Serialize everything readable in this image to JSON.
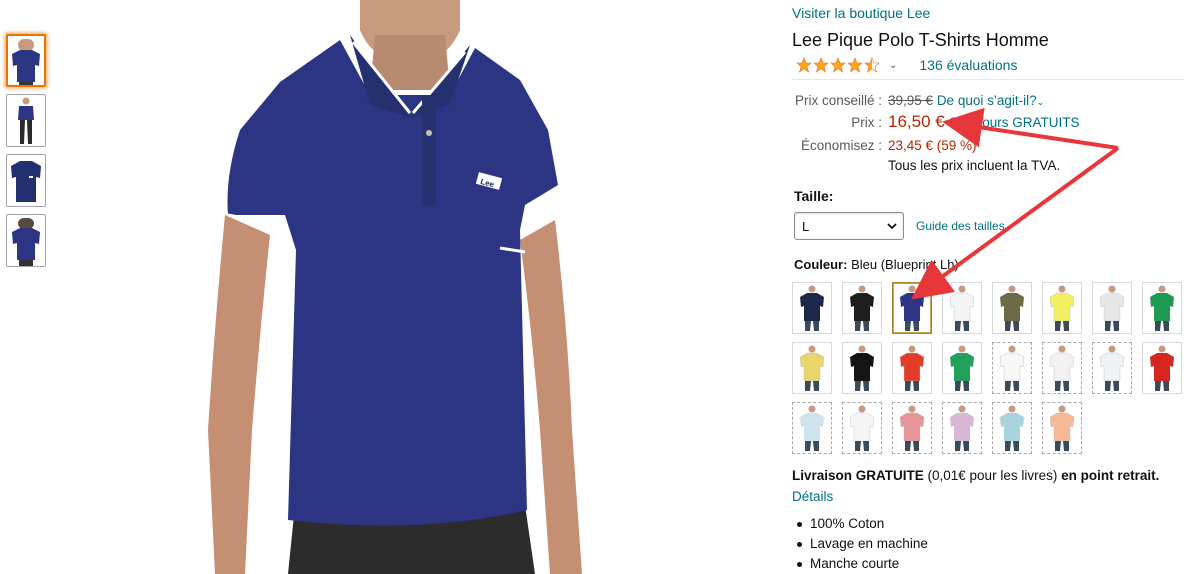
{
  "store": {
    "link": "Visiter la boutique Lee"
  },
  "product": {
    "title": "Lee Pique Polo T-Shirts Homme",
    "rating": 4.5,
    "rating_count": "136 évaluations"
  },
  "pricing": {
    "list_label": "Prix conseillé :",
    "list_price": "39,95 €",
    "list_help": "De quoi s’agit-il?",
    "price_label": "Prix :",
    "price": "16,50 €",
    "price_suffix": "& Retours GRATUITS",
    "save_label": "Économisez :",
    "save_value": "23,45 € (59 %)",
    "vat_note": "Tous les prix incluent la TVA."
  },
  "size": {
    "label": "Taille:",
    "selected": "L",
    "guide": "Guide des tailles"
  },
  "color": {
    "label": "Couleur:",
    "value": "Bleu (Blueprint Lh)",
    "swatches": [
      {
        "name": "navy-polo",
        "color": "#1d2749",
        "selected": false,
        "dashed": false
      },
      {
        "name": "black-polo",
        "color": "#1e1e1e",
        "selected": false,
        "dashed": false
      },
      {
        "name": "blue-polo",
        "color": "#2b3584",
        "selected": true,
        "dashed": false
      },
      {
        "name": "white-polo",
        "color": "#f4f4f4",
        "selected": false,
        "dashed": false
      },
      {
        "name": "olive-polo",
        "color": "#6b6a45",
        "selected": false,
        "dashed": false
      },
      {
        "name": "yellow-polo",
        "color": "#f2ef63",
        "selected": false,
        "dashed": false
      },
      {
        "name": "grey-white-polo",
        "color": "#e6e6e6",
        "selected": false,
        "dashed": false
      },
      {
        "name": "green-polo",
        "color": "#1f9a55",
        "selected": false,
        "dashed": false
      },
      {
        "name": "mustard-polo",
        "color": "#e8d66a",
        "selected": false,
        "dashed": false
      },
      {
        "name": "black-polo-2",
        "color": "#151515",
        "selected": false,
        "dashed": false
      },
      {
        "name": "red-polo",
        "color": "#e43c2b",
        "selected": false,
        "dashed": false
      },
      {
        "name": "green-polo-2",
        "color": "#23a05a",
        "selected": false,
        "dashed": false
      },
      {
        "name": "white-polo-2",
        "color": "#f7f7f7",
        "selected": false,
        "dashed": true
      },
      {
        "name": "white-polo-3",
        "color": "#f2f2f2",
        "selected": false,
        "dashed": true
      },
      {
        "name": "white-polo-4",
        "color": "#eef2f4",
        "selected": false,
        "dashed": true
      },
      {
        "name": "red-polo-2",
        "color": "#d7261d",
        "selected": false,
        "dashed": false
      },
      {
        "name": "striped-polo",
        "color": "#cfe3ef",
        "selected": false,
        "dashed": true
      },
      {
        "name": "white-polo-5",
        "color": "#f5f5f5",
        "selected": false,
        "dashed": true
      },
      {
        "name": "pink-polo",
        "color": "#e69497",
        "selected": false,
        "dashed": true
      },
      {
        "name": "lilac-striped-polo",
        "color": "#d9b7d6",
        "selected": false,
        "dashed": true
      },
      {
        "name": "light-blue-polo",
        "color": "#a8d3dc",
        "selected": false,
        "dashed": true
      },
      {
        "name": "peach-polo",
        "color": "#f7b897",
        "selected": false,
        "dashed": true
      }
    ]
  },
  "delivery": {
    "lead": "Livraison GRATUITE",
    "middle": " (0,01€ pour les livres) ",
    "tail": "en point retrait.",
    "details": "Détails"
  },
  "features": [
    "100% Coton",
    "Lavage en machine",
    "Manche courte"
  ],
  "thumbnails": [
    {
      "name": "thumb-front",
      "selected": true
    },
    {
      "name": "thumb-full-body",
      "selected": false
    },
    {
      "name": "thumb-flat",
      "selected": false
    },
    {
      "name": "thumb-back",
      "selected": false
    }
  ],
  "colors": {
    "accent_red": "#b12704",
    "link": "#007185",
    "star": "#ffa41c",
    "annotation_arrow": "#e8373b",
    "shirt": "#2b3584"
  }
}
